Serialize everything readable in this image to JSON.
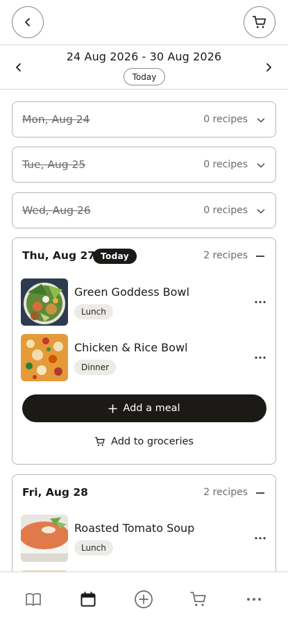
{
  "header": {
    "back_icon": "chevron-left-icon",
    "cart_icon": "shopping-cart-icon"
  },
  "week": {
    "range": "24 Aug 2026 - 30 Aug 2026",
    "today_label": "Today",
    "prev_icon": "chevron-left-icon",
    "next_icon": "chevron-right-icon"
  },
  "days": [
    {
      "label": "Mon, Aug 24",
      "count": "0 recipes",
      "past": true,
      "expanded": false
    },
    {
      "label": "Tue, Aug 25",
      "count": "0 recipes",
      "past": true,
      "expanded": false
    },
    {
      "label": "Wed, Aug 26",
      "count": "0 recipes",
      "past": true,
      "expanded": false
    },
    {
      "label": "Thu, Aug 27",
      "badge": "Today",
      "count": "2 recipes",
      "expanded": true,
      "recipes": [
        {
          "name": "Green Goddess Bowl",
          "meal": "Lunch"
        },
        {
          "name": "Chicken & Rice Bowl",
          "meal": "Dinner"
        }
      ],
      "add_meal": "Add a meal",
      "add_groceries": "Add to groceries"
    },
    {
      "label": "Fri, Aug 28",
      "count": "2 recipes",
      "expanded": true,
      "recipes": [
        {
          "name": "Roasted Tomato Soup",
          "meal": "Lunch"
        }
      ]
    }
  ],
  "bottom_nav": [
    {
      "icon": "book-icon"
    },
    {
      "icon": "calendar-icon",
      "active": true
    },
    {
      "icon": "plus-circle-icon"
    },
    {
      "icon": "shopping-cart-icon"
    },
    {
      "icon": "more-horizontal-icon"
    }
  ],
  "colors": {
    "ink": "#1c1a17",
    "muted": "#6d6a66",
    "border": "#b9b6b2",
    "chip": "#ecebe8"
  }
}
